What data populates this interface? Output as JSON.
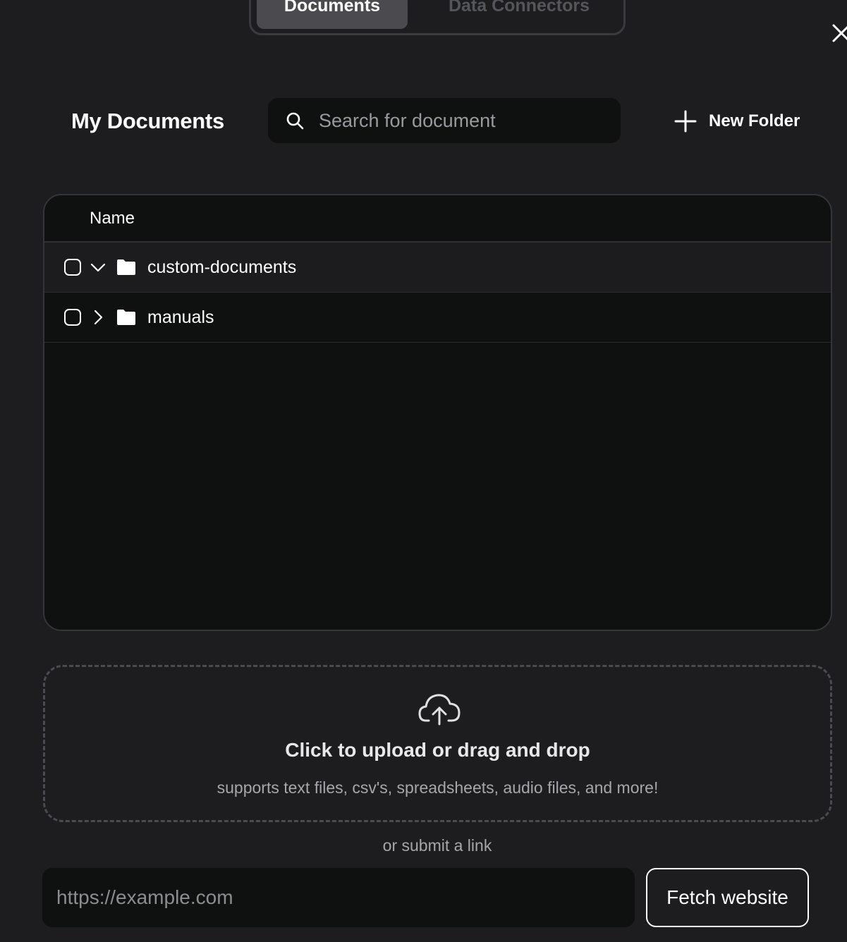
{
  "tabs": {
    "documents_label": "Documents",
    "connectors_label": "Data Connectors"
  },
  "header": {
    "title": "My Documents",
    "new_folder_label": "New Folder"
  },
  "search": {
    "placeholder": "Search for document",
    "value": ""
  },
  "table": {
    "column_name": "Name",
    "rows": [
      {
        "name": "custom-documents",
        "expanded": true,
        "type": "folder"
      },
      {
        "name": "manuals",
        "expanded": false,
        "type": "folder"
      }
    ]
  },
  "upload": {
    "title": "Click to upload or drag and drop",
    "subtitle": "supports text files, csv's, spreadsheets, audio files, and more!",
    "or_link": "or submit a link"
  },
  "link": {
    "placeholder": "https://example.com",
    "value": "",
    "button_label": "Fetch website"
  },
  "icons": {
    "close": "close-icon",
    "search": "search-icon",
    "plus": "plus-icon",
    "folder": "folder-icon",
    "chevron_down": "chevron-down-icon",
    "chevron_right": "chevron-right-icon",
    "upload": "cloud-upload-icon"
  },
  "colors": {
    "background": "#1d1d20",
    "panel": "#0f1010",
    "active_tab": "#4a4a4f",
    "text": "#ffffff",
    "muted_text": "#a7a7ab"
  }
}
